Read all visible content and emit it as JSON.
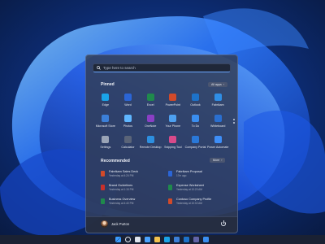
{
  "start_menu": {
    "search": {
      "placeholder": "Type here to search"
    },
    "pinned": {
      "title": "Pinned",
      "all_apps_label": "All apps",
      "apps": [
        {
          "label": "Edge",
          "icon": "edge-icon",
          "color": "#1aa3e8"
        },
        {
          "label": "Word",
          "icon": "word-icon",
          "color": "#2b65d6"
        },
        {
          "label": "Excel",
          "icon": "excel-icon",
          "color": "#1f8a4c"
        },
        {
          "label": "PowerPoint",
          "icon": "powerpoint-icon",
          "color": "#d14a2a"
        },
        {
          "label": "Outlook",
          "icon": "outlook-icon",
          "color": "#1d72c9"
        },
        {
          "label": "Fabrikam",
          "icon": "fabrikam-icon",
          "color": "#2f8ee6"
        },
        {
          "label": "Microsoft Store",
          "icon": "store-icon",
          "color": "#3b7fd8"
        },
        {
          "label": "Photos",
          "icon": "photos-icon",
          "color": "#5fb6ff"
        },
        {
          "label": "OneNote",
          "icon": "onenote-icon",
          "color": "#8a3fc4"
        },
        {
          "label": "Your Phone",
          "icon": "phone-icon",
          "color": "#4da0f0"
        },
        {
          "label": "To Do",
          "icon": "todo-icon",
          "color": "#3a8ef0"
        },
        {
          "label": "Whiteboard",
          "icon": "whiteboard-icon",
          "color": "#2a6fd0"
        },
        {
          "label": "Settings",
          "icon": "settings-icon",
          "color": "#9aa4b6"
        },
        {
          "label": "Calculator",
          "icon": "calculator-icon",
          "color": "#5a6478"
        },
        {
          "label": "Remote Desktop",
          "icon": "remote-desktop-icon",
          "color": "#2d8fe0"
        },
        {
          "label": "Snipping Tool",
          "icon": "snipping-tool-icon",
          "color": "#d84a8a"
        },
        {
          "label": "Company Portal",
          "icon": "company-portal-icon",
          "color": "#2a78d8"
        },
        {
          "label": "Power Automate",
          "icon": "power-automate-icon",
          "color": "#3e8ef7"
        }
      ]
    },
    "recommended": {
      "title": "Recommended",
      "more_label": "More",
      "items": [
        {
          "title": "Fabrikam Sales Deck",
          "subtitle": "Yesterday at 4:24 PM",
          "icon": "powerpoint-file-icon",
          "color": "#d14a2a"
        },
        {
          "title": "Fabrikam Proposal",
          "subtitle": "17m ago",
          "icon": "word-file-icon",
          "color": "#2b65d6"
        },
        {
          "title": "Brand Guidelines",
          "subtitle": "Yesterday at 1:15 PM",
          "icon": "pdf-file-icon",
          "color": "#c8302a"
        },
        {
          "title": "Expense Worksheet",
          "subtitle": "Yesterday at 10:20 AM",
          "icon": "excel-file-icon",
          "color": "#1f8a4c"
        },
        {
          "title": "Business Overview",
          "subtitle": "Yesterday at 4:40 PM",
          "icon": "excel-file-icon",
          "color": "#1f8a4c"
        },
        {
          "title": "Contoso Company Profile",
          "subtitle": "Yesterday at 10:02 AM",
          "icon": "powerpoint-file-icon",
          "color": "#d14a2a"
        }
      ]
    },
    "user": {
      "name": "Jack Purton"
    }
  },
  "taskbar": {
    "icons": [
      {
        "name": "start-icon",
        "color": "#3a9cff"
      },
      {
        "name": "search-icon",
        "color": "#dfe4ee"
      },
      {
        "name": "task-view-icon",
        "color": "#dfe4ee"
      },
      {
        "name": "widgets-icon",
        "color": "#4aa3ff"
      },
      {
        "name": "file-explorer-icon",
        "color": "#f2c14e"
      },
      {
        "name": "edge-icon",
        "color": "#1aa3e8"
      },
      {
        "name": "store-icon",
        "color": "#3b7fd8"
      },
      {
        "name": "outlook-icon",
        "color": "#1d72c9"
      },
      {
        "name": "teams-icon",
        "color": "#6264a7"
      },
      {
        "name": "mail-icon",
        "color": "#3a8ef0"
      }
    ]
  }
}
